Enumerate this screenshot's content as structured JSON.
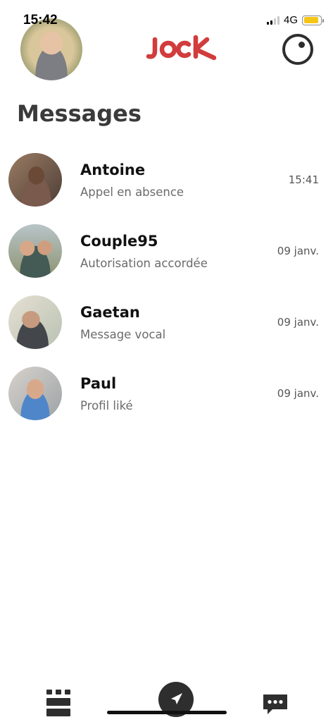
{
  "status_bar": {
    "time": "15:42",
    "network": "4G",
    "signal_bars_active": 2,
    "signal_bars_total": 4,
    "battery_level": 0.9,
    "battery_color": "#f5c518"
  },
  "header": {
    "logo_text": "jock",
    "logo_color": "#d23c3c",
    "profile_avatar_icon": "user-avatar",
    "camera_icon": "camera-lens-icon"
  },
  "page": {
    "title": "Messages"
  },
  "conversations": [
    {
      "name": "Antoine",
      "preview": "Appel en absence",
      "time": "15:41"
    },
    {
      "name": "Couple95",
      "preview": "Autorisation accordée",
      "time": "09 janv."
    },
    {
      "name": "Gaetan",
      "preview": "Message vocal",
      "time": "09 janv."
    },
    {
      "name": "Paul",
      "preview": "Profil liké",
      "time": "09 janv."
    }
  ],
  "tab_bar": {
    "items": [
      {
        "icon": "grid-icon"
      },
      {
        "icon": "compass-icon"
      },
      {
        "icon": "chat-bubble-icon"
      }
    ]
  }
}
